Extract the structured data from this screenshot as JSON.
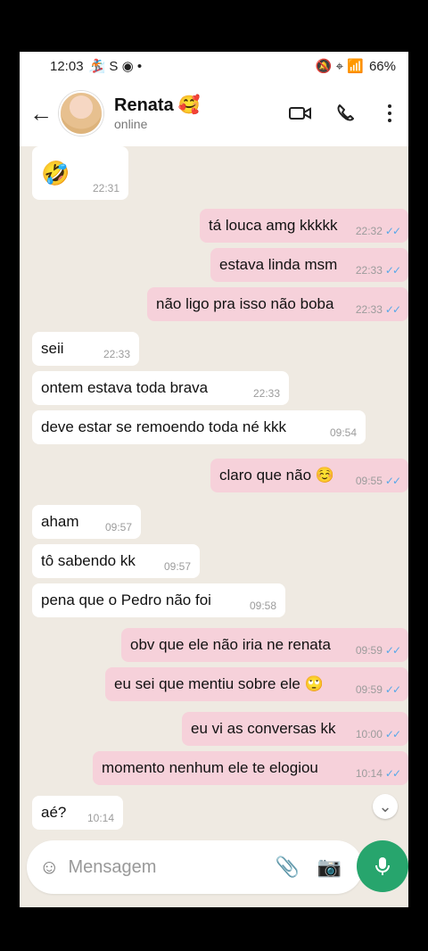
{
  "status": {
    "time": "12:03",
    "left_icons": "🏂 S ◉ •",
    "right_icons": "🔕 ⌖ 📶",
    "battery": "66%"
  },
  "header": {
    "name": "Renata",
    "emoji": "🥰",
    "status": "online"
  },
  "messages": [
    {
      "type": "in",
      "text": "🤣",
      "time": "22:31"
    },
    {
      "type": "out",
      "text": "tá louca amg kkkkk",
      "time": "22:32"
    },
    {
      "type": "out",
      "text": "estava linda msm",
      "time": "22:33"
    },
    {
      "type": "out",
      "text": "não ligo pra isso não boba",
      "time": "22:33"
    },
    {
      "type": "in",
      "text": "seii",
      "time": "22:33"
    },
    {
      "type": "in",
      "text": "ontem estava toda brava",
      "time": "22:33"
    },
    {
      "type": "in",
      "text": "deve estar se remoendo toda né kkk",
      "time": "09:54"
    },
    {
      "type": "out",
      "text": "claro que não ☺️",
      "time": "09:55"
    },
    {
      "type": "in",
      "text": "aham",
      "time": "09:57"
    },
    {
      "type": "in",
      "text": "tô sabendo kk",
      "time": "09:57"
    },
    {
      "type": "in",
      "text": "pena que o Pedro não foi",
      "time": "09:58"
    },
    {
      "type": "out",
      "text": "obv que ele não iria ne renata",
      "time": "09:59"
    },
    {
      "type": "out",
      "text": "eu sei que mentiu sobre ele 🙄",
      "time": "09:59"
    },
    {
      "type": "out",
      "text": "eu vi as conversas kk",
      "time": "10:00"
    },
    {
      "type": "out",
      "text": "momento nenhum ele te elogiou",
      "time": "10:14"
    },
    {
      "type": "in",
      "text": "aé?",
      "time": "10:14"
    }
  ],
  "composer": {
    "placeholder": "Mensagem"
  },
  "icons": {
    "back": "arrow-left-icon",
    "video": "video-icon",
    "call": "phone-icon",
    "menu": "more-vertical-icon",
    "emoji": "emoji-icon",
    "attach": "paperclip-icon",
    "camera": "camera-icon",
    "mic": "mic-icon",
    "scroll": "chevrons-down-icon"
  },
  "colors": {
    "incoming": "#ffffff",
    "outgoing": "#f6d1da",
    "accent": "#27a56d",
    "read_check": "#58a8e8"
  }
}
